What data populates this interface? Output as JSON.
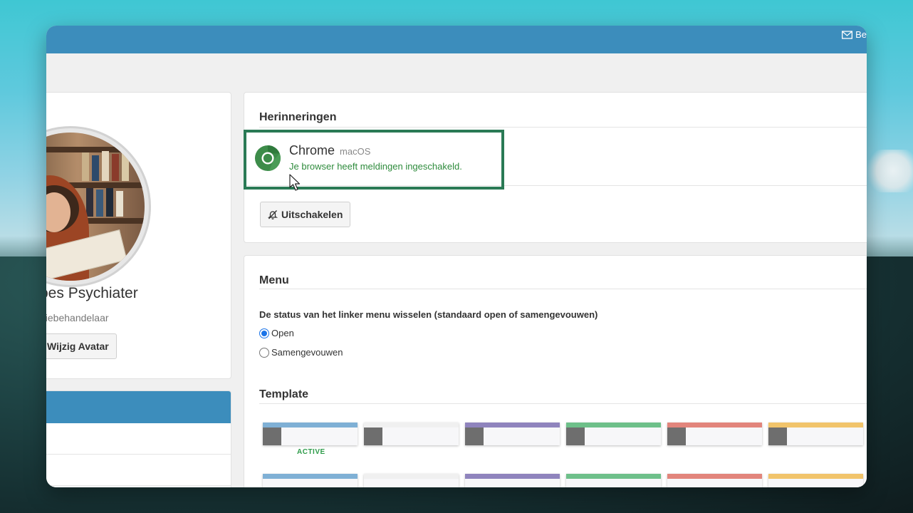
{
  "topbar": {
    "mail_label": "Be"
  },
  "profile": {
    "name": "oes Psychiater",
    "subtitle": "giebehandelaar",
    "change_avatar_label": "Wijzig Avatar"
  },
  "reminders": {
    "title": "Herinneringen",
    "browser_name": "Chrome",
    "browser_os": "macOS",
    "status_text": "Je browser heeft meldingen ingeschakeld.",
    "disable_label": "Uitschakelen"
  },
  "menu": {
    "title": "Menu",
    "description": "De status van het linker menu wisselen (standaard open of samengevouwen)",
    "options": [
      {
        "label": "Open",
        "selected": true
      },
      {
        "label": "Samengevouwen",
        "selected": false
      }
    ]
  },
  "template": {
    "title": "Template",
    "active_label": "ACTIVE",
    "colors": [
      "#7fb0d5",
      "#f0f0f0",
      "#8f84bd",
      "#6ec08a",
      "#e2857c",
      "#f1c46b"
    ]
  },
  "colors": {
    "topbar": "#3c8dbc",
    "highlight": "#2a7a55",
    "status_green": "#2e8b3c"
  }
}
